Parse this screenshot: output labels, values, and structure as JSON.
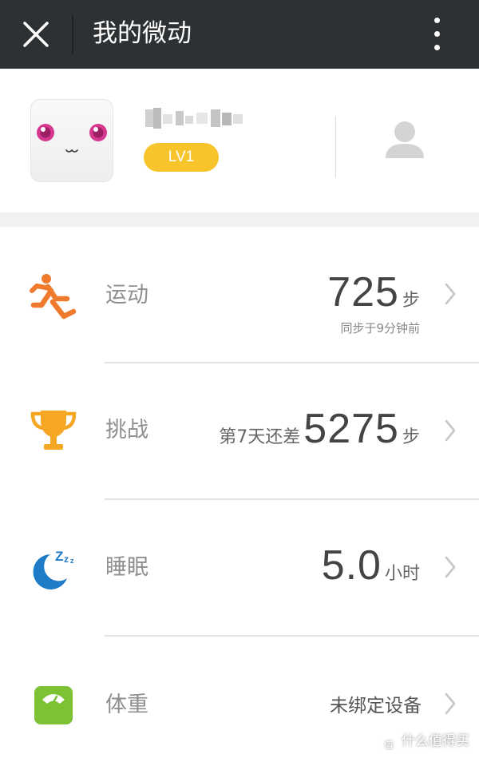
{
  "header": {
    "title": "我的微动",
    "background": "#2e3133"
  },
  "profile": {
    "nickname": "",
    "level": "LV1",
    "level_color": "#f7c42c"
  },
  "rows": [
    {
      "label": "运动",
      "icon": "running-icon",
      "value": "725",
      "unit": "步",
      "subtext": "同步于9分钟前",
      "accent": "#f07a2d"
    },
    {
      "label": "挑战",
      "icon": "trophy-icon",
      "prefix": "第7天还差",
      "value": "5275",
      "unit": "步",
      "accent": "#f5a623"
    },
    {
      "label": "睡眠",
      "icon": "sleep-moon-icon",
      "value": "5.0",
      "unit": "小时",
      "accent": "#1e7bc8"
    },
    {
      "label": "体重",
      "icon": "scale-icon",
      "status": "未绑定设备",
      "accent": "#7cc233"
    }
  ],
  "watermark": {
    "badge": "值",
    "text": "什么值得买"
  }
}
